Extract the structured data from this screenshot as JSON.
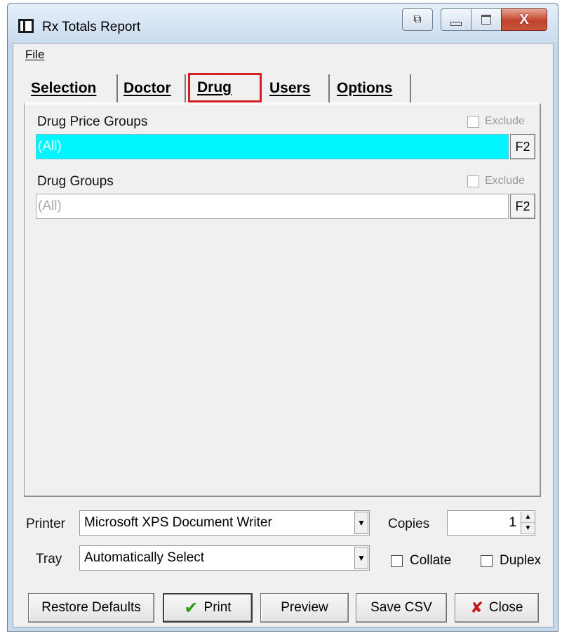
{
  "window": {
    "title": "Rx Totals Report",
    "caption_restore_glyph": "⧉",
    "caption_close_glyph": "X"
  },
  "menu": {
    "file": "File"
  },
  "tabs": {
    "selection": "Selection",
    "doctor": "Doctor",
    "drug": "Drug",
    "users": "Users",
    "options": "Options",
    "active": "Drug"
  },
  "drug_tab": {
    "drug_price_groups": {
      "label": "Drug Price Groups",
      "exclude_label": "Exclude",
      "exclude_checked": false,
      "value": "(All)",
      "lookup_button": "F2"
    },
    "drug_groups": {
      "label": "Drug Groups",
      "exclude_label": "Exclude",
      "exclude_checked": false,
      "value": "(All)",
      "lookup_button": "F2"
    }
  },
  "print_settings": {
    "printer_label": "Printer",
    "printer_value": "Microsoft XPS Document Writer",
    "tray_label": "Tray",
    "tray_value": "Automatically Select",
    "copies_label": "Copies",
    "copies_value": "1",
    "collate_label": "Collate",
    "collate_checked": false,
    "duplex_label": "Duplex",
    "duplex_checked": false
  },
  "buttons": {
    "restore_defaults": "Restore Defaults",
    "print": "Print",
    "preview": "Preview",
    "save_csv": "Save CSV",
    "close": "Close"
  },
  "colors": {
    "highlight_field": "#00f6ff",
    "tab_highlight_border": "#d31e22",
    "print_check": "#2b9a14",
    "close_x": "#c4161c"
  }
}
